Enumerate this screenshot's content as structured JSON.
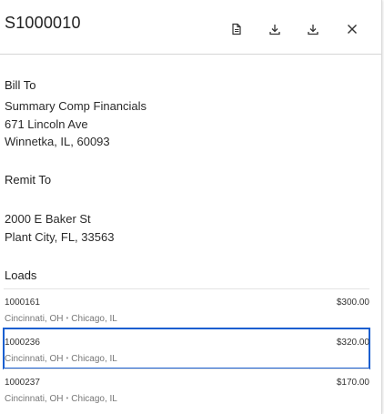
{
  "header": {
    "title": "S1000010",
    "icons": [
      "document-icon",
      "download-icon",
      "download-icon",
      "close-icon"
    ]
  },
  "bill_to": {
    "label": "Bill To",
    "lines": [
      "Summary Comp Financials",
      "671 Lincoln Ave",
      "Winnetka, IL, 60093"
    ]
  },
  "remit_to": {
    "label": "Remit To",
    "lines": [
      "2000 E Baker St",
      "Plant City, FL, 33563"
    ]
  },
  "loads": {
    "label": "Loads",
    "items": [
      {
        "id": "1000161",
        "amount": "$300.00",
        "origin": "Cincinnati, OH",
        "destination": "Chicago, IL",
        "selected": false
      },
      {
        "id": "1000236",
        "amount": "$320.00",
        "origin": "Cincinnati, OH",
        "destination": "Chicago, IL",
        "selected": true
      },
      {
        "id": "1000237",
        "amount": "$170.00",
        "origin": "Cincinnati, OH",
        "destination": "Chicago, IL",
        "selected": false
      }
    ],
    "route_separator": "•"
  },
  "colors": {
    "selection_border": "#1a5fd0",
    "divider": "#d6d6d6",
    "muted_text": "#777777"
  }
}
